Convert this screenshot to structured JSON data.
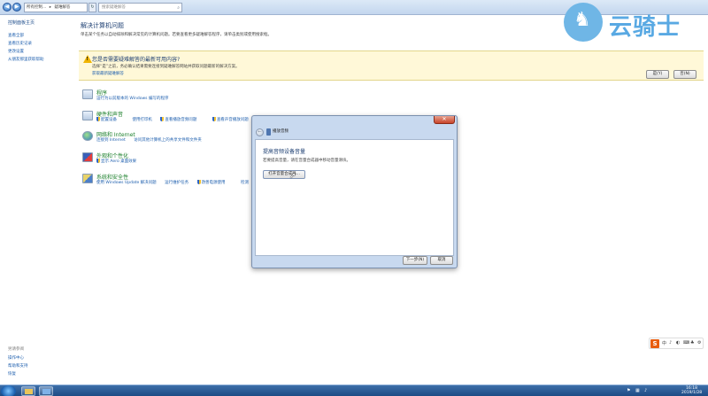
{
  "address": {
    "crumbs": [
      "所有控制...",
      "疑难解答"
    ],
    "refresh": "↻",
    "search_placeholder": "搜索疑难解答"
  },
  "left_pane": {
    "title": "控制面板主页",
    "links": [
      "查看全部",
      "查看历史记录",
      "更改设置",
      "从朋友那里获取帮助"
    ],
    "see_also_title": "另请参阅",
    "see_also": [
      "操作中心",
      "帮助和支持",
      "恢复"
    ]
  },
  "main": {
    "title": "解决计算机问题",
    "description": "单击某个任务以自动排除和解决常见的计算机问题。若要查看更多疑难解答程序，请单击类别或使用搜索框。",
    "notice": {
      "title": "您是否需要疑难解答的最新可用内容?",
      "text": "选择“是”之前，务必确认结果需要连接到疑难解答网站并获取问题最新的解决方案。",
      "link": "获取最新疑难解答",
      "yes": "是(Y)",
      "no": "否(N)"
    },
    "categories": [
      {
        "title": "程序",
        "links": [
          "运行为以前版本的 Windows 编写的程序"
        ]
      },
      {
        "title": "硬件和声音",
        "links": [
          "配置设备",
          "使用打印机",
          "查看播放音频问题",
          "查看声音播放问题"
        ]
      },
      {
        "title": "网络和 Internet",
        "links": [
          "连接到 Internet",
          "访问其他计算机上的共享文件和文件夹"
        ]
      },
      {
        "title": "外观和个性化",
        "links": [
          "显示 Aero 桌面效果"
        ]
      },
      {
        "title": "系统和安全性",
        "links": [
          "使用 Windows Update 解决问题",
          "运行维护任务",
          "改善电源使用",
          "检测"
        ]
      }
    ]
  },
  "dialog": {
    "title": "播放音频",
    "close": "✕",
    "back": "←",
    "heading": "提高音频设备音量",
    "description": "若要提高音量，请在音量合成器中移动音量滑块。",
    "open_button": "打开音量合成器...",
    "next": "下一步(N)",
    "cancel": "取消"
  },
  "watermark": {
    "text": "云骑士"
  },
  "tray_widget": {
    "s": "S",
    "items": [
      "中",
      "♪",
      "◐",
      "⌨",
      "♣",
      "⚙"
    ]
  },
  "taskbar": {
    "time": "16:18",
    "date": "2019/1/28"
  }
}
